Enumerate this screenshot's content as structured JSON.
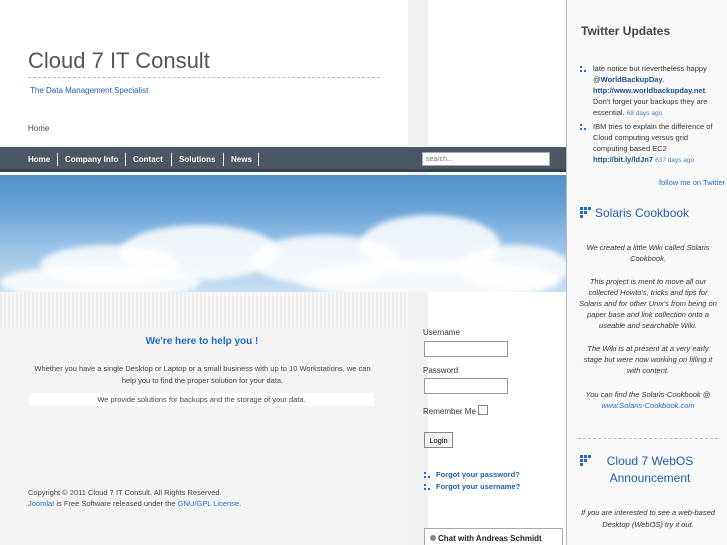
{
  "site": {
    "title": "Cloud 7 IT Consult",
    "tagline": "The Data Management Specialist",
    "breadcrumb": "Home"
  },
  "nav": {
    "items": [
      "Home",
      "Company Info",
      "Contact",
      "Solutions",
      "News"
    ],
    "search_placeholder": "search..."
  },
  "main": {
    "heading": "We're here to help you !",
    "text": "Whether you have a single Desktop or Laptop or a small business with up to 10 Workstations, we can help you to find the proper solution for your data.",
    "solutions": "We provide solutions for backups and the storage of your data.",
    "copyright": "Copyright © 2011 Cloud 7 IT Consult. All Rights Reserved.",
    "joomla_link": "Joomla!",
    "joomla_text": " is Free Software released under the ",
    "license_link": "GNU/GPL License",
    "license_end": "."
  },
  "login": {
    "username_label": "Username",
    "password_label": "Password",
    "remember_label": "Remember Me",
    "login_button": "Login",
    "forgot_password": "Forgot your password?",
    "forgot_username": "Forgot your username?"
  },
  "chat": {
    "label": "Chat with Andreas Schmidt"
  },
  "twitter": {
    "heading": "Twitter Updates",
    "tweets": [
      {
        "pre": "late notice but nevertheless happy @",
        "handle": "WorldBackupDay",
        "mid": ". ",
        "link": "http://www.worldbackupday.net",
        "post": ". Don't forget your backups they are essential. ",
        "time": "68 days ago"
      },
      {
        "pre": "IBM tries to explain the difference of Cloud computing versus grid computing based EC2 ",
        "link": "http://bit.ly/ldJn7",
        "time": "637 days ago"
      }
    ],
    "follow": "follow me on Twitter"
  },
  "solaris": {
    "heading": "Solaris Cookbook",
    "p1": "We created a little Wiki called Solaris Cookbook.",
    "p2": "This project is ment to move all our collected Howto's, tricks and tips for Solaris and for other Unix's from being on paper base and link collection onto a useable and searchable Wiki.",
    "p3": "The Wiki is at present at a very early stage but were now working on filling it with content.",
    "p4": "You can find the Solaris-Cookbook @",
    "p4_link": "www.Solaris-Cookbook.com"
  },
  "webos": {
    "heading": "Cloud 7 WebOS Announcement",
    "text": "If you are  interested to see a web-based Desktop (WebOS) try it out."
  },
  "colors": {
    "accent": "#1f6ac4",
    "navbar": "#4b5863"
  }
}
